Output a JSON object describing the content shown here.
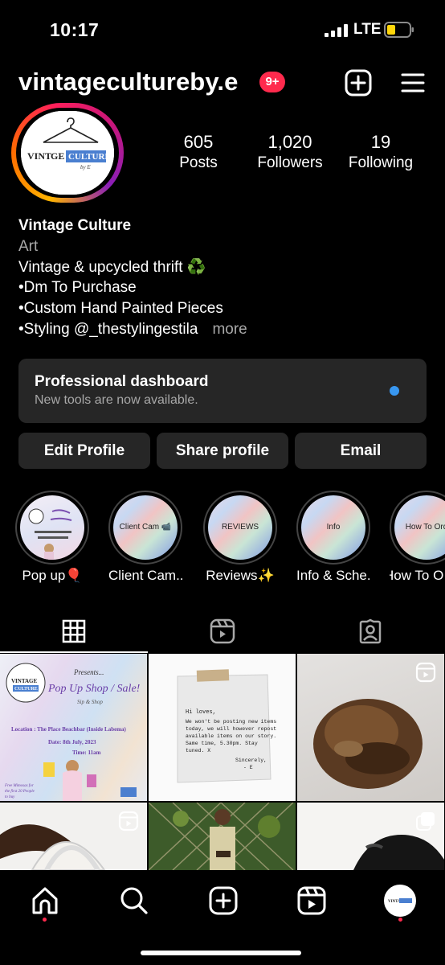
{
  "status": {
    "time": "10:17",
    "network": "LTE"
  },
  "header": {
    "username": "vintagecultureby.e",
    "notification_count": "9+"
  },
  "avatar": {
    "brand_text": "VINTAGE CULTURE"
  },
  "stats": [
    {
      "value": "605",
      "label": "Posts"
    },
    {
      "value": "1,020",
      "label": "Followers"
    },
    {
      "value": "19",
      "label": "Following"
    }
  ],
  "bio": {
    "name": "Vintage Culture",
    "category": "Art",
    "lines": [
      "Vintage & upcycled thrift ♻️",
      "•Dm To Purchase",
      "•Custom Hand Painted Pieces",
      "•Styling @_thestylingestila"
    ],
    "more": "more"
  },
  "dashboard": {
    "title": "Professional dashboard",
    "subtitle": "New tools are now available."
  },
  "actions": {
    "edit": "Edit Profile",
    "share": "Share profile",
    "email": "Email"
  },
  "highlights": [
    {
      "label": "Pop up🎈",
      "cover_text": ""
    },
    {
      "label": "Client Cam...",
      "cover_text": "Client Cam 📹"
    },
    {
      "label": "Reviews✨",
      "cover_text": "REVIEWS"
    },
    {
      "label": "Info & Sche...",
      "cover_text": "Info"
    },
    {
      "label": "How To O",
      "cover_text": "How To Ord"
    }
  ],
  "posts": {
    "popup": {
      "presents": "Presents...",
      "title": "Pop Up Shop / Sale!",
      "subtitle": "Sip & Shop",
      "location": "Location : The Place Beachbar (Inside Labema)",
      "date": "Date: 8th July, 2023",
      "time": "Time: 11am",
      "promo": "Free Mimosas for the first 20 People to buy"
    },
    "note": {
      "lines": [
        "Hi loves,",
        "We won't be posting new items today, we will however repost available items on our story. Same time, 5.30pm. Stay tuned. X"
      ],
      "signoff": "Sincerely,",
      "sign": "- E"
    }
  },
  "colors": {
    "background": "#000000",
    "surface": "#262626",
    "badge": "#ff2a4d",
    "accent": "#3897f0",
    "muted": "#a8a8a8"
  }
}
